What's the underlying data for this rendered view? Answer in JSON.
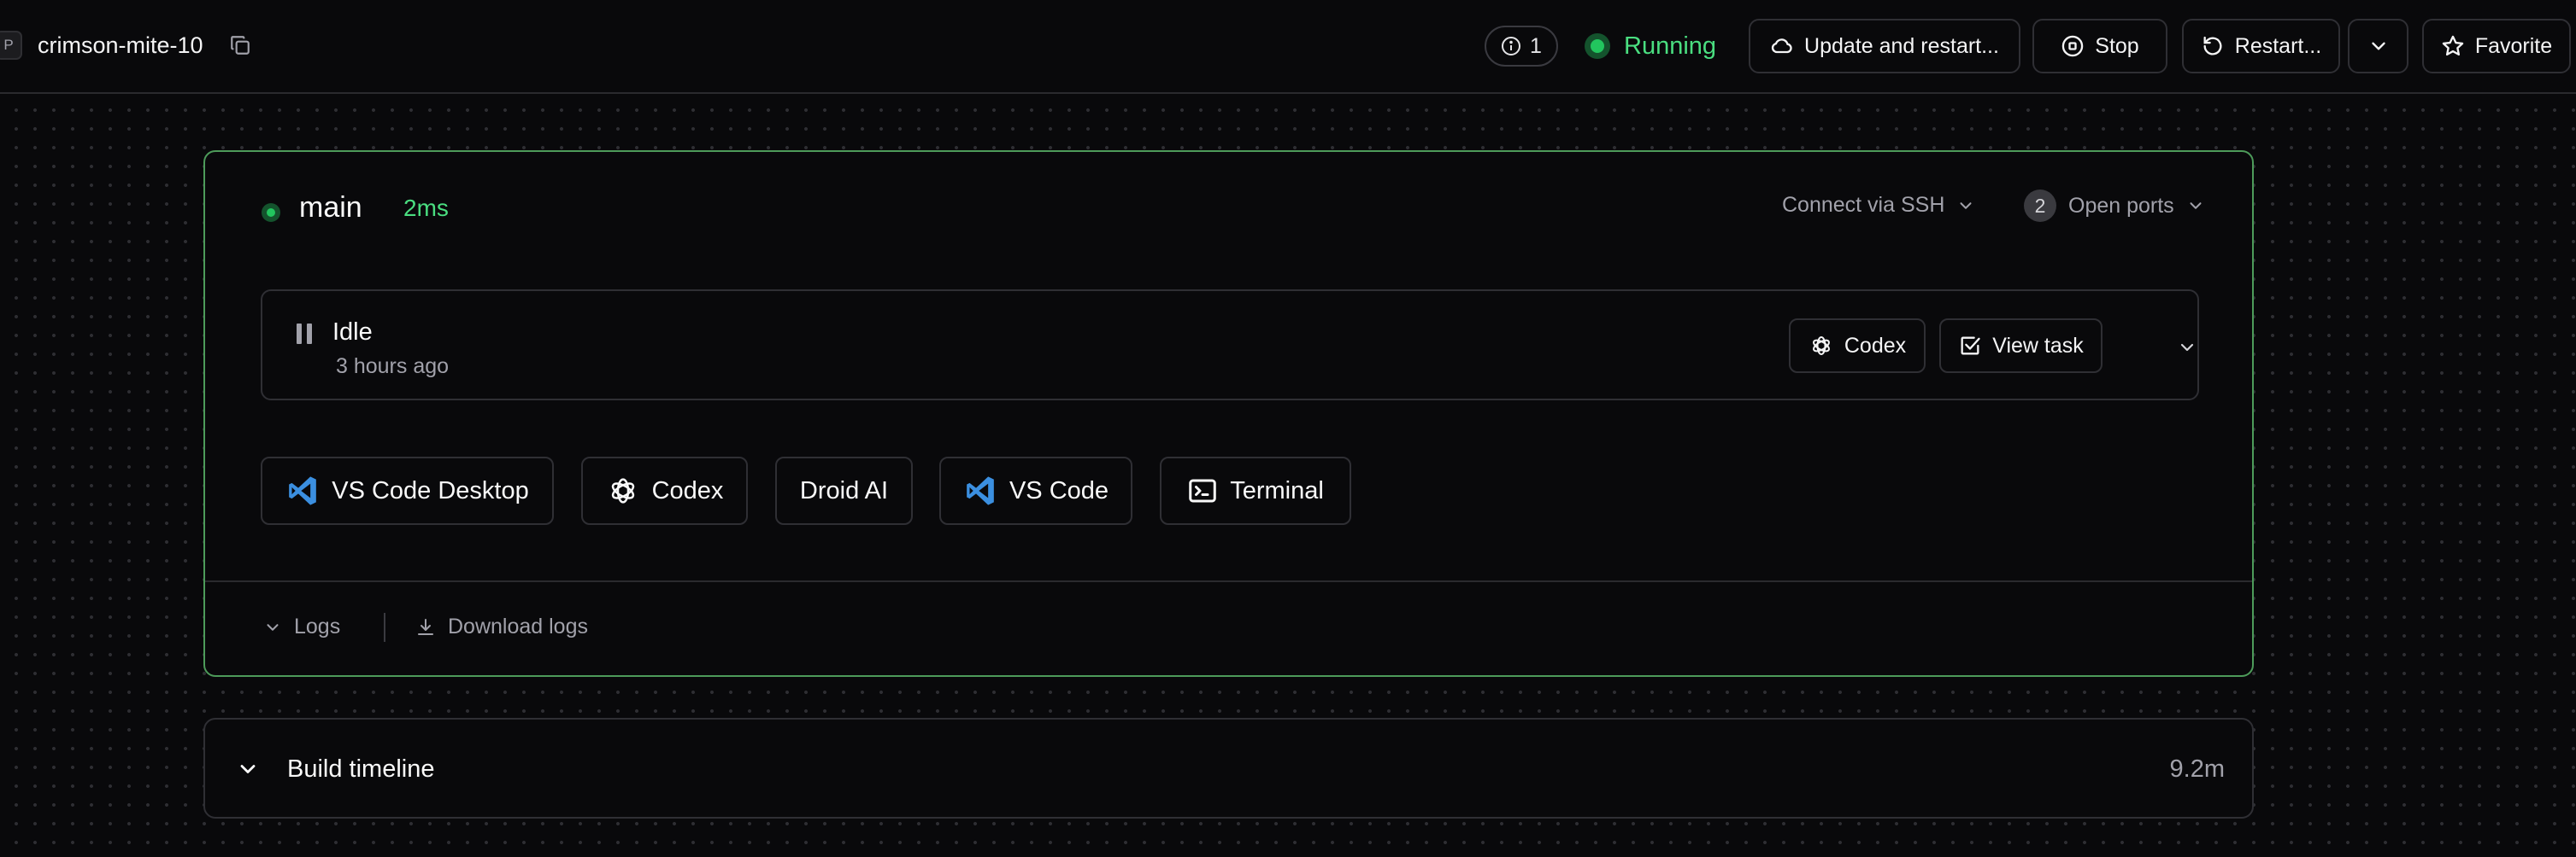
{
  "header": {
    "workspace_initial": "P",
    "workspace_name": "crimson-mite-10",
    "info_count": "1",
    "status": "Running",
    "update_restart_label": "Update and restart...",
    "stop_label": "Stop",
    "restart_label": "Restart...",
    "favorite_label": "Favorite"
  },
  "agent": {
    "name": "main",
    "latency": "2ms",
    "connect_ssh_label": "Connect via SSH",
    "open_ports_count": "2",
    "open_ports_label": "Open ports",
    "task": {
      "status": "Idle",
      "time": "3 hours ago",
      "codex_label": "Codex",
      "view_task_label": "View task"
    },
    "apps": [
      {
        "label": "VS Code Desktop",
        "icon": "vscode-icon"
      },
      {
        "label": "Codex",
        "icon": "openai-icon"
      },
      {
        "label": "Droid AI",
        "icon": ""
      },
      {
        "label": "VS Code",
        "icon": "vscode-icon"
      },
      {
        "label": "Terminal",
        "icon": "terminal-icon"
      }
    ],
    "logs_label": "Logs",
    "download_logs_label": "Download logs"
  },
  "timeline": {
    "title": "Build timeline",
    "duration": "9.2m"
  },
  "colors": {
    "background": "#09090b",
    "accent_green": "#4ade80",
    "active_border": "#4d9b5a",
    "vscode_blue": "#3b8fe0"
  }
}
